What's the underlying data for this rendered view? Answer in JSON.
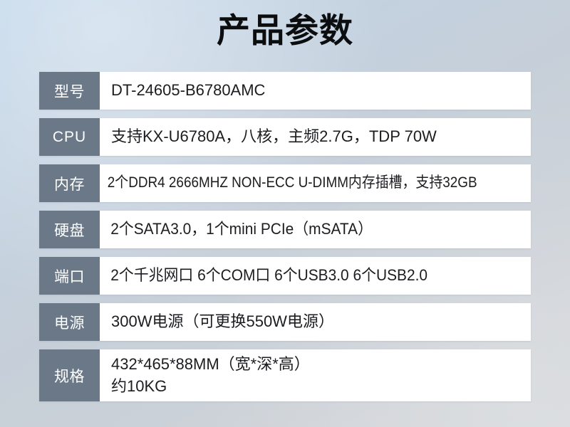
{
  "page": {
    "title": "产品参数",
    "background_top_color": "#bdd4e9",
    "background_bottom_color": "#d4d7da",
    "label_cell_color": "#6b7888",
    "value_cell_color": "#ffffff",
    "title_color": "#0c0d0e"
  },
  "spec_table": {
    "rows": [
      {
        "label": "型号",
        "value": "DT-24605-B6780AMC"
      },
      {
        "label": "CPU",
        "value": "支持KX-U6780A，八核，主频2.7G，TDP 70W"
      },
      {
        "label": "内存",
        "value": "2个DDR4 2666MHZ NON-ECC U-DIMM内存插槽，支持32GB"
      },
      {
        "label": "硬盘",
        "value": "2个SATA3.0，1个mini PCIe（mSATA）"
      },
      {
        "label": "端口",
        "value": "2个千兆网口  6个COM口  6个USB3.0  6个USB2.0"
      },
      {
        "label": "电源",
        "value": "300W电源（可更换550W电源）"
      },
      {
        "label": "规格",
        "value_line1": "432*465*88MM（宽*深*高）",
        "value_line2": "约10KG"
      }
    ]
  }
}
